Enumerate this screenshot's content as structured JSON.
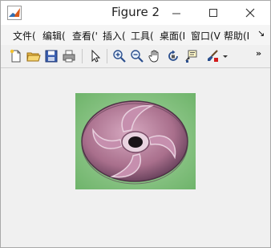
{
  "window": {
    "title": "Figure 2",
    "icon": "matlab-logo-icon"
  },
  "title_buttons": [
    "minimize-icon",
    "maximize-icon",
    "close-icon"
  ],
  "menu": {
    "items": [
      "文件(",
      "编辑(",
      "查看('",
      "插入(",
      "工具(",
      "桌面(I",
      "窗口(V",
      "帮助(I"
    ],
    "more": "↘"
  },
  "toolbar": {
    "icons": [
      "new-figure-icon",
      "open-file-icon",
      "save-icon",
      "print-icon",
      "select-arrow-icon",
      "zoom-in-icon",
      "zoom-out-icon",
      "pan-hand-icon",
      "rotate-3d-icon",
      "data-cursor-icon",
      "brush-icon",
      "dropdown-arrow-icon"
    ],
    "overflow": "»"
  },
  "figure": {
    "image": "impeller-photo",
    "image_colors": {
      "background": "#8fc98a",
      "part": "#b97a98",
      "highlight": "#e9d3e0"
    }
  }
}
